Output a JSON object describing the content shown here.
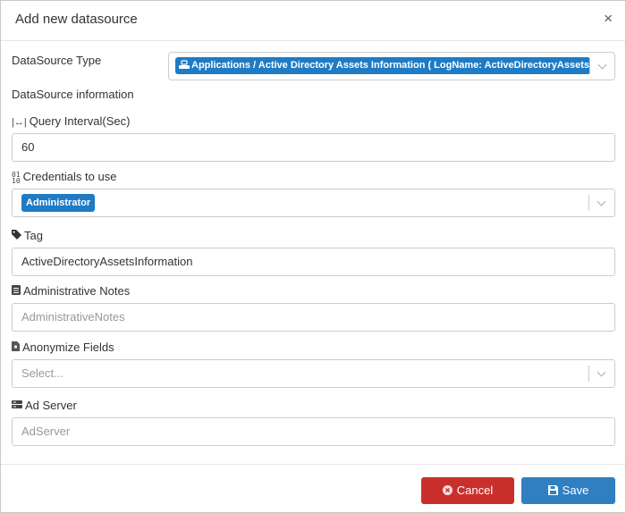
{
  "dialog": {
    "title": "Add new datasource",
    "close_label": "×"
  },
  "datasource_type": {
    "label": "DataSource Type",
    "value": "Applications / Active Directory Assets Information ( LogName: ActiveDirectoryAssetsInformation )"
  },
  "datasource_info_label": "DataSource information",
  "query_interval": {
    "label": "Query Interval(Sec)",
    "value": "60"
  },
  "credentials": {
    "label": "Credentials to use",
    "value": "Administrator"
  },
  "tag": {
    "label": "Tag",
    "value": "ActiveDirectoryAssetsInformation"
  },
  "admin_notes": {
    "label": "Administrative Notes",
    "placeholder": "AdministrativeNotes"
  },
  "anonymize": {
    "label": "Anonymize Fields",
    "placeholder": "Select..."
  },
  "ad_server": {
    "label": "Ad Server",
    "placeholder": "AdServer"
  },
  "buttons": {
    "cancel": "Cancel",
    "save": "Save"
  },
  "colors": {
    "primary": "#2f7fc1",
    "danger": "#c9302c",
    "chip": "#1f7bc4"
  }
}
